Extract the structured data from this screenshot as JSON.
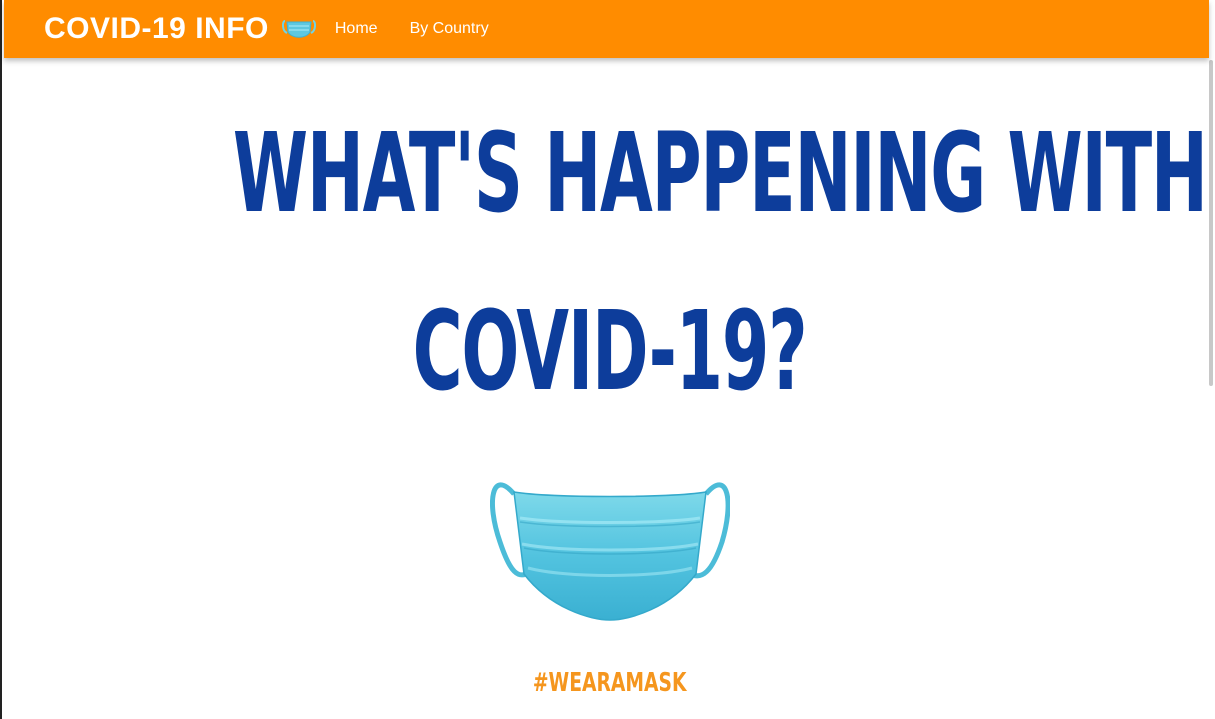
{
  "navbar": {
    "brand": "COVID-19 INFO",
    "brand_icon": "face-mask-icon",
    "links": [
      {
        "label": "Home"
      },
      {
        "label": "By Country"
      }
    ],
    "background_color": "#ff8c00"
  },
  "hero": {
    "title_line1": "What's happening with",
    "title_line2": "COVID-19?",
    "title_color": "#0d3d9b",
    "image": "surgical-mask-image",
    "hashtag": "#WEARAMASK",
    "hashtag_color": "#f5961e"
  }
}
